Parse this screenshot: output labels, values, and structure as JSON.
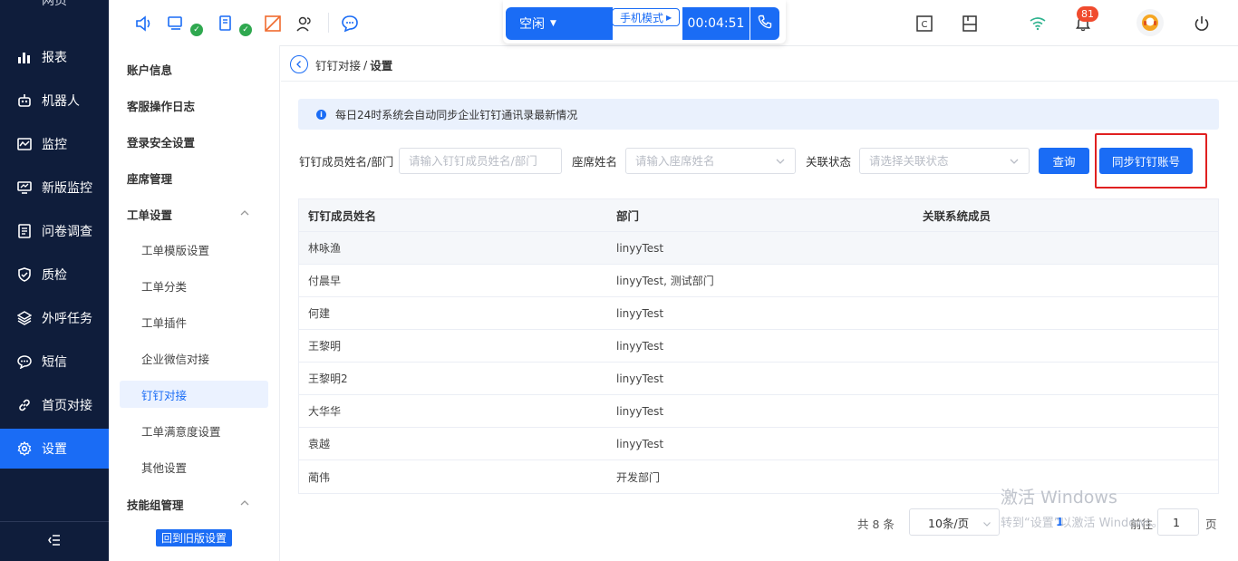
{
  "app": {
    "top_cut_label": "网页"
  },
  "nav": {
    "items": [
      {
        "label": "报表",
        "icon": "bar-chart-icon"
      },
      {
        "label": "机器人",
        "icon": "robot-icon"
      },
      {
        "label": "监控",
        "icon": "monitor-icon"
      },
      {
        "label": "新版监控",
        "icon": "screen-icon"
      },
      {
        "label": "问卷调查",
        "icon": "survey-icon"
      },
      {
        "label": "质检",
        "icon": "shield-icon"
      },
      {
        "label": "外呼任务",
        "icon": "layers-icon"
      },
      {
        "label": "短信",
        "icon": "message-icon"
      },
      {
        "label": "首页对接",
        "icon": "link-icon"
      },
      {
        "label": "设置",
        "icon": "gear-icon"
      }
    ],
    "active": "设置",
    "collapse_icon": "collapse-icon"
  },
  "subnav": {
    "items": [
      {
        "label": "账户信息",
        "type": "top"
      },
      {
        "label": "客服操作日志",
        "type": "top"
      },
      {
        "label": "登录安全设置",
        "type": "top"
      },
      {
        "label": "座席管理",
        "type": "top"
      },
      {
        "label": "工单设置",
        "type": "group"
      },
      {
        "label": "工单模版设置",
        "type": "child"
      },
      {
        "label": "工单分类",
        "type": "child"
      },
      {
        "label": "工单插件",
        "type": "child"
      },
      {
        "label": "企业微信对接",
        "type": "child"
      },
      {
        "label": "钉钉对接",
        "type": "child"
      },
      {
        "label": "工单满意度设置",
        "type": "child"
      },
      {
        "label": "其他设置",
        "type": "child"
      },
      {
        "label": "技能组管理",
        "type": "group"
      }
    ],
    "active": "钉钉对接",
    "old_version_button": "回到旧版设置"
  },
  "topbar": {
    "status": "空闲",
    "mode": "手机模式",
    "timer": "00:04:51",
    "notification_count": "81"
  },
  "breadcrumb": {
    "parent": "钉钉对接",
    "separator": "/",
    "current": "设置"
  },
  "notice": "每日24时系统会自动同步企业钉钉通讯录最新情况",
  "filters": {
    "member_label": "钉钉成员姓名/部门",
    "member_placeholder": "请输入钉钉成员姓名/部门",
    "seat_label": "座席姓名",
    "seat_placeholder": "请输入座席姓名",
    "status_label": "关联状态",
    "status_placeholder": "请选择关联状态",
    "query_button": "查询",
    "sync_button": "同步钉钉账号"
  },
  "table": {
    "columns": [
      "钉钉成员姓名",
      "部门",
      "关联系统成员"
    ],
    "rows": [
      [
        "林咏渔",
        "linyyTest",
        ""
      ],
      [
        "付晨早",
        "linyyTest, 测试部门",
        ""
      ],
      [
        "何建",
        "linyyTest",
        ""
      ],
      [
        "王黎明",
        "linyyTest",
        ""
      ],
      [
        "王黎明2",
        "linyyTest",
        ""
      ],
      [
        "大华华",
        "linyyTest",
        ""
      ],
      [
        "袁越",
        "linyyTest",
        ""
      ],
      [
        "蔺伟",
        "开发部门",
        ""
      ]
    ]
  },
  "pagination": {
    "total": "共 8 条",
    "page_size": "10条/页",
    "current_page": "1",
    "goto_label": "前往",
    "goto_value": "1",
    "page_suffix": "页"
  },
  "watermark": {
    "line1": "激活 Windows",
    "line2": "转到“设置”以激活 Windows。"
  },
  "colors": {
    "nav_bg": "#0f1d3b",
    "accent": "#1a6cf5",
    "highlight_box": "#e02020",
    "badge": "#f04b2e"
  }
}
